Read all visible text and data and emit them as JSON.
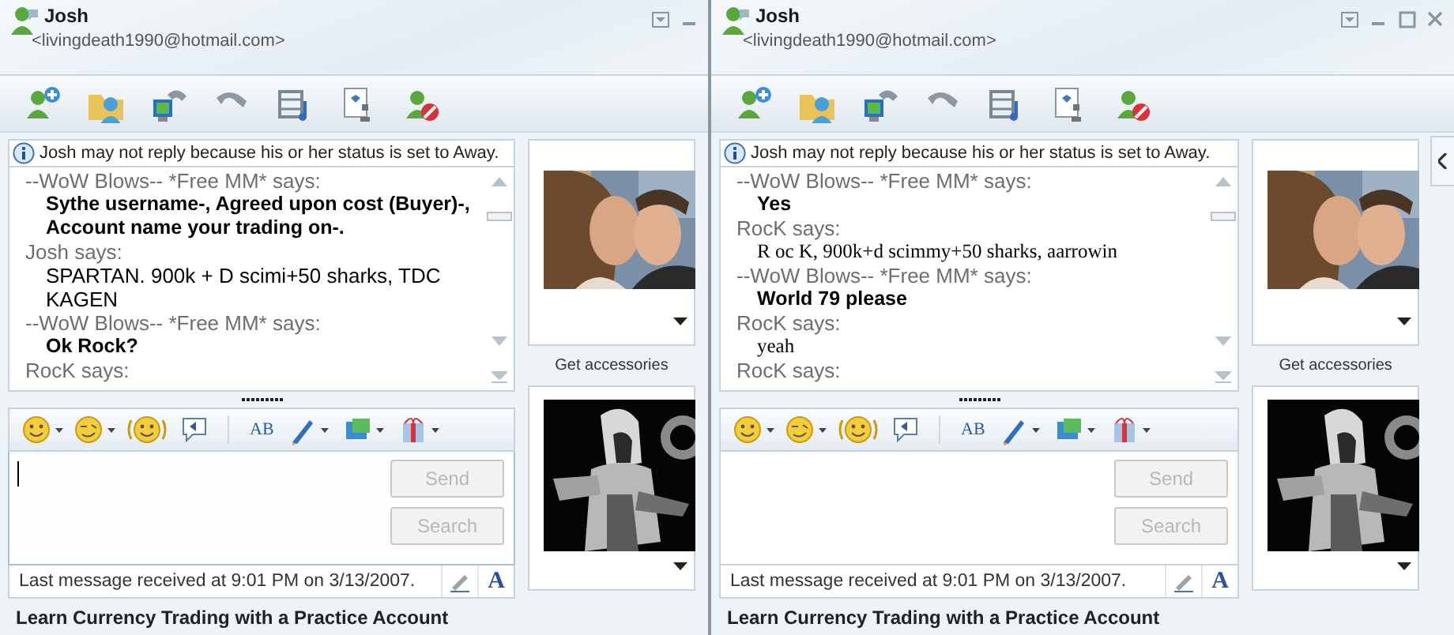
{
  "windows": [
    {
      "contact": {
        "name": "Josh",
        "email": "<livingdeath1990@hotmail.com>"
      },
      "clipped_right": true,
      "notice": "Josh may not reply because his or her status is set to Away.",
      "messages": [
        {
          "sender": "--WoW Blows-- *Free MM* says:",
          "text": "Sythe username-, Agreed upon cost (Buyer)-, Account name your trading on-.",
          "kind": "bold"
        },
        {
          "sender": "Josh says:",
          "text": "SPARTAN. 900k + D scimi+50 sharks, TDC KAGEN",
          "kind": "sans"
        },
        {
          "sender": "--WoW Blows-- *Free MM* says:",
          "text": "Ok Rock?",
          "kind": "bold"
        },
        {
          "sender": "RocK says:"
        }
      ],
      "spell_label": "AB",
      "input": {
        "focused": true
      },
      "buttons": [
        {
          "label": "Send",
          "disabled": true
        },
        {
          "label": "Search",
          "disabled": true
        }
      ],
      "status": "Last message received at 9:01 PM on 3/13/2007.",
      "font_button": "A",
      "accessories": "Get accessories",
      "ad": "Learn Currency Trading with a Practice Account"
    },
    {
      "contact": {
        "name": "Josh",
        "email": "<livingdeath1990@hotmail.com>"
      },
      "clipped_right": false,
      "notice": "Josh may not reply because his or her status is set to Away.",
      "messages": [
        {
          "sender": "--WoW Blows-- *Free MM* says:",
          "text": "Yes",
          "kind": "bold"
        },
        {
          "sender": "RocK says:",
          "text": "R oc K, 900k+d scimmy+50 sharks, aarrowin",
          "kind": "serif"
        },
        {
          "sender": "--WoW Blows-- *Free MM* says:",
          "text": "World 79 please",
          "kind": "bold"
        },
        {
          "sender": "RocK says:",
          "text": "yeah",
          "kind": "serif"
        },
        {
          "sender": "RocK says:"
        }
      ],
      "spell_label": "AB",
      "input": {
        "focused": false
      },
      "buttons": [
        {
          "label": "Send",
          "disabled": true
        },
        {
          "label": "Search",
          "disabled": true
        }
      ],
      "status": "Last message received at 9:01 PM on 3/13/2007.",
      "font_button": "A",
      "accessories": "Get accessories",
      "ad": "Learn Currency Trading with a Practice Account"
    }
  ]
}
